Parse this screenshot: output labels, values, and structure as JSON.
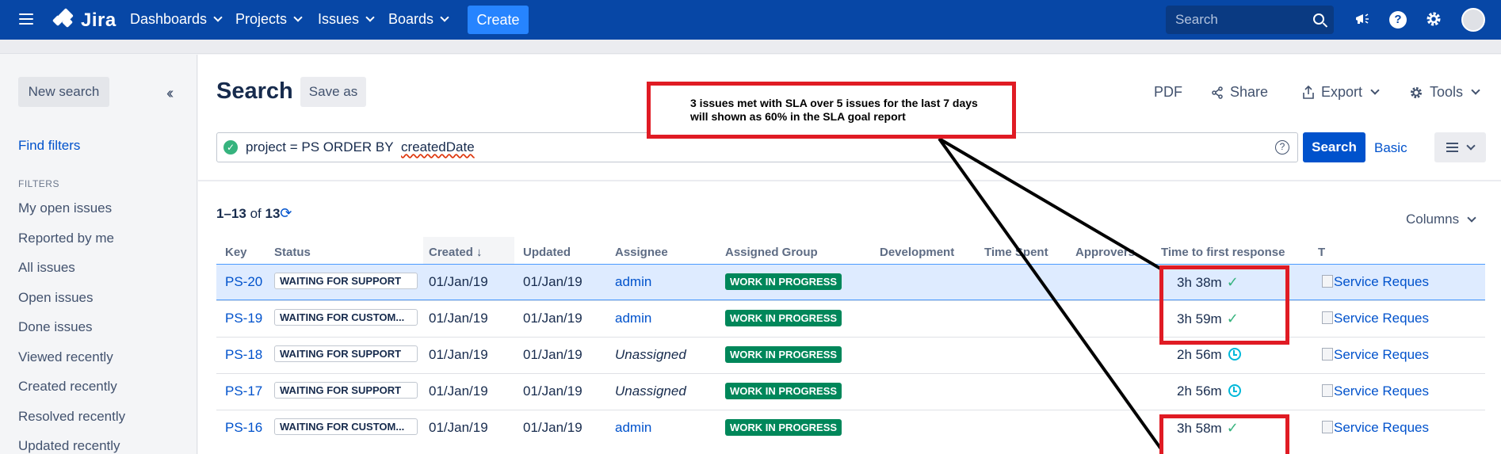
{
  "topnav": {
    "logo": "Jira",
    "items": [
      "Dashboards",
      "Projects",
      "Issues",
      "Boards"
    ],
    "create_label": "Create",
    "search_placeholder": "Search"
  },
  "sidebar": {
    "new_search": "New search",
    "find_filters": "Find filters",
    "filters_header": "FILTERS",
    "filters": [
      "My open issues",
      "Reported by me",
      "All issues",
      "Open issues",
      "Done issues",
      "Viewed recently",
      "Created recently",
      "Resolved recently",
      "Updated recently"
    ]
  },
  "main": {
    "title": "Search",
    "save_as": "Save as",
    "pdf": "PDF",
    "share": "Share",
    "export": "Export",
    "tools": "Tools",
    "query_prefix": "project = PS ORDER BY",
    "query_field": "createdDate",
    "search_button": "Search",
    "basic_link": "Basic",
    "count_range": "1–13",
    "count_of": "of",
    "count_total": "13",
    "columns_button": "Columns"
  },
  "table": {
    "headers": [
      "Key",
      "Status",
      "Created",
      "Updated",
      "Assignee",
      "Assigned Group",
      "Development",
      "Time Spent",
      "Approvers",
      "Time to first response",
      "T"
    ],
    "rows": [
      {
        "key": "PS-20",
        "status": "WAITING FOR SUPPORT",
        "created": "01/Jan/19",
        "updated": "01/Jan/19",
        "assignee": "admin",
        "group": "WORK IN PROGRESS",
        "ttfr": "3h 38m",
        "type": "Service Reques"
      },
      {
        "key": "PS-19",
        "status": "WAITING FOR CUSTOM...",
        "created": "01/Jan/19",
        "updated": "01/Jan/19",
        "assignee": "admin",
        "group": "WORK IN PROGRESS",
        "ttfr": "3h 59m",
        "type": "Service Reques"
      },
      {
        "key": "PS-18",
        "status": "WAITING FOR SUPPORT",
        "created": "01/Jan/19",
        "updated": "01/Jan/19",
        "assignee": "Unassigned",
        "group": "WORK IN PROGRESS",
        "ttfr": "2h 56m",
        "type": "Service Reques"
      },
      {
        "key": "PS-17",
        "status": "WAITING FOR SUPPORT",
        "created": "01/Jan/19",
        "updated": "01/Jan/19",
        "assignee": "Unassigned",
        "group": "WORK IN PROGRESS",
        "ttfr": "2h 56m",
        "type": "Service Reques"
      },
      {
        "key": "PS-16",
        "status": "WAITING FOR CUSTOM...",
        "created": "01/Jan/19",
        "updated": "01/Jan/19",
        "assignee": "admin",
        "group": "WORK IN PROGRESS",
        "ttfr": "3h 58m",
        "type": "Service Reques"
      }
    ]
  },
  "annotation": {
    "line1": "3 issues met with SLA over  5 issues for the last 7 days",
    "line2": "will shown as 60% in the SLA goal report",
    "color": "#e01b24"
  }
}
